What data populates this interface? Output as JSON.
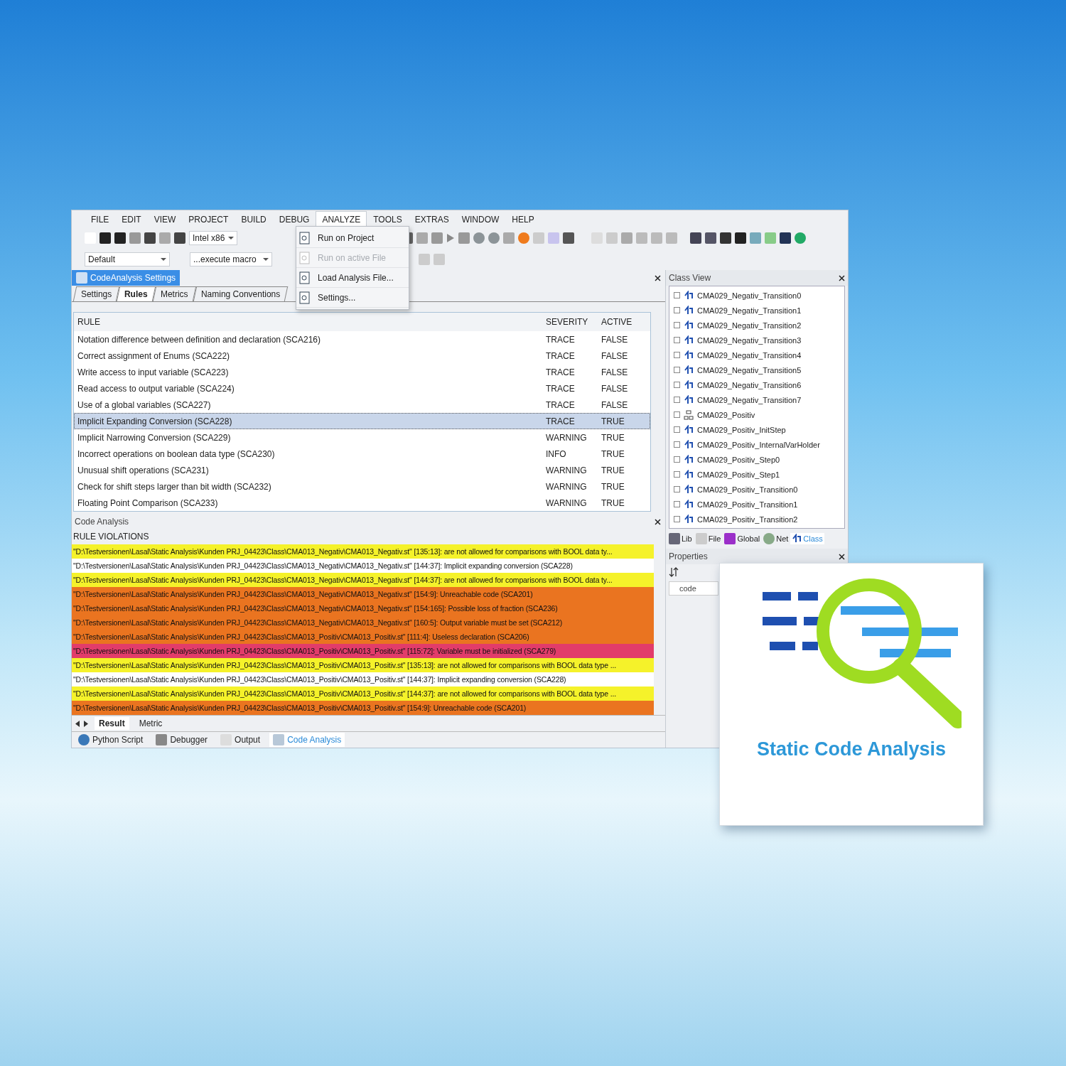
{
  "menu": [
    {
      "label": "FILE",
      "selected": false
    },
    {
      "label": "EDIT",
      "selected": false
    },
    {
      "label": "VIEW",
      "selected": false
    },
    {
      "label": "PROJECT",
      "selected": false
    },
    {
      "label": "BUILD",
      "selected": false
    },
    {
      "label": "DEBUG",
      "selected": false
    },
    {
      "label": "ANALYZE",
      "selected": true
    },
    {
      "label": "TOOLS",
      "selected": false
    },
    {
      "label": "EXTRAS",
      "selected": false
    },
    {
      "label": "WINDOW",
      "selected": false
    },
    {
      "label": "HELP",
      "selected": false
    }
  ],
  "analyze_menu": [
    {
      "label": "Run on Project",
      "disabled": false
    },
    {
      "label": "Run on active File",
      "disabled": true
    },
    {
      "label": "Load Analysis File...",
      "disabled": false
    },
    {
      "label": "Settings...",
      "disabled": false
    }
  ],
  "toolbar": {
    "platform": "Intel x86",
    "configuration": "Default",
    "macro": "...execute macro"
  },
  "document_tab": "CodeAnalysis Settings",
  "settings_tabs": [
    {
      "label": "Settings",
      "selected": false
    },
    {
      "label": "Rules",
      "selected": true
    },
    {
      "label": "Metrics",
      "selected": false
    },
    {
      "label": "Naming Conventions",
      "selected": false
    }
  ],
  "rules_table": {
    "columns": [
      "RULE",
      "SEVERITY",
      "ACTIVE"
    ],
    "rows": [
      {
        "rule": "Notation difference between definition and declaration (SCA216)",
        "severity": "TRACE",
        "active": "FALSE",
        "selected": false
      },
      {
        "rule": "Correct assignment of Enums (SCA222)",
        "severity": "TRACE",
        "active": "FALSE",
        "selected": false
      },
      {
        "rule": "Write access to input variable (SCA223)",
        "severity": "TRACE",
        "active": "FALSE",
        "selected": false
      },
      {
        "rule": "Read access to output variable (SCA224)",
        "severity": "TRACE",
        "active": "FALSE",
        "selected": false
      },
      {
        "rule": "Use of a global variables (SCA227)",
        "severity": "TRACE",
        "active": "FALSE",
        "selected": false
      },
      {
        "rule": "Implicit Expanding Conversion (SCA228)",
        "severity": "TRACE",
        "active": "TRUE",
        "selected": true
      },
      {
        "rule": "Implicit Narrowing Conversion (SCA229)",
        "severity": "WARNING",
        "active": "TRUE",
        "selected": false
      },
      {
        "rule": "Incorrect operations on boolean data type (SCA230)",
        "severity": "INFO",
        "active": "TRUE",
        "selected": false
      },
      {
        "rule": "Unusual shift operations (SCA231)",
        "severity": "WARNING",
        "active": "TRUE",
        "selected": false
      },
      {
        "rule": "Check for shift steps larger than bit width (SCA232)",
        "severity": "WARNING",
        "active": "TRUE",
        "selected": false
      },
      {
        "rule": "Floating Point Comparison (SCA233)",
        "severity": "WARNING",
        "active": "TRUE",
        "selected": false
      }
    ]
  },
  "code_analysis": {
    "title": "Code Analysis",
    "heading": "RULE VIOLATIONS",
    "rows": [
      {
        "text": "\"D:\\Testversionen\\Lasal\\Static Analysis\\Kunden PRJ_04423\\Class\\CMA013_Negativ\\CMA013_Negativ.st\" [135:13]: are not allowed for comparisons with BOOL data ty...",
        "color": "#f5f22a"
      },
      {
        "text": "\"D:\\Testversionen\\Lasal\\Static Analysis\\Kunden PRJ_04423\\Class\\CMA013_Negativ\\CMA013_Negativ.st\" [144:37]: Implicit expanding conversion (SCA228)",
        "color": "#ffffff"
      },
      {
        "text": "\"D:\\Testversionen\\Lasal\\Static Analysis\\Kunden PRJ_04423\\Class\\CMA013_Negativ\\CMA013_Negativ.st\" [144:37]: are not allowed for comparisons with BOOL data ty...",
        "color": "#f5f22a"
      },
      {
        "text": "\"D:\\Testversionen\\Lasal\\Static Analysis\\Kunden PRJ_04423\\Class\\CMA013_Negativ\\CMA013_Negativ.st\" [154:9]: Unreachable code (SCA201)",
        "color": "#ea7420"
      },
      {
        "text": "\"D:\\Testversionen\\Lasal\\Static Analysis\\Kunden PRJ_04423\\Class\\CMA013_Negativ\\CMA013_Negativ.st\" [154:165]: Possible loss of fraction (SCA236)",
        "color": "#ea7420"
      },
      {
        "text": "\"D:\\Testversionen\\Lasal\\Static Analysis\\Kunden PRJ_04423\\Class\\CMA013_Negativ\\CMA013_Negativ.st\" [160:5]: Output variable must be set (SCA212)",
        "color": "#ea7420"
      },
      {
        "text": "\"D:\\Testversionen\\Lasal\\Static Analysis\\Kunden PRJ_04423\\Class\\CMA013_Positiv\\CMA013_Positiv.st\" [111:4]: Useless declaration (SCA206)",
        "color": "#ea7420"
      },
      {
        "text": "\"D:\\Testversionen\\Lasal\\Static Analysis\\Kunden PRJ_04423\\Class\\CMA013_Positiv\\CMA013_Positiv.st\" [115:72]: Variable must be initialized (SCA279)",
        "color": "#e23c6a"
      },
      {
        "text": "\"D:\\Testversionen\\Lasal\\Static Analysis\\Kunden PRJ_04423\\Class\\CMA013_Positiv\\CMA013_Positiv.st\" [135:13]: are not allowed for comparisons with BOOL data type ...",
        "color": "#f5f22a"
      },
      {
        "text": "\"D:\\Testversionen\\Lasal\\Static Analysis\\Kunden PRJ_04423\\Class\\CMA013_Positiv\\CMA013_Positiv.st\" [144:37]: Implicit expanding conversion (SCA228)",
        "color": "#ffffff"
      },
      {
        "text": "\"D:\\Testversionen\\Lasal\\Static Analysis\\Kunden PRJ_04423\\Class\\CMA013_Positiv\\CMA013_Positiv.st\" [144:37]: are not allowed for comparisons with BOOL data type ...",
        "color": "#f5f22a"
      },
      {
        "text": "\"D:\\Testversionen\\Lasal\\Static Analysis\\Kunden PRJ_04423\\Class\\CMA013_Positiv\\CMA013_Positiv.st\" [154:9]: Unreachable code (SCA201)",
        "color": "#ea7420"
      }
    ]
  },
  "result_tabs": [
    {
      "label": "Result",
      "selected": true
    },
    {
      "label": "Metric",
      "selected": false
    }
  ],
  "output_tabs": [
    {
      "label": "Python Script",
      "kind": "python",
      "selected": false
    },
    {
      "label": "Debugger",
      "kind": "debugger",
      "selected": false
    },
    {
      "label": "Output",
      "kind": "output",
      "selected": false
    },
    {
      "label": "Code Analysis",
      "kind": "analysis",
      "selected": true
    }
  ],
  "class_view": {
    "title": "Class View",
    "items": [
      {
        "label": "CMA029_Negativ_Transition0",
        "kind": "transition"
      },
      {
        "label": "CMA029_Negativ_Transition1",
        "kind": "transition"
      },
      {
        "label": "CMA029_Negativ_Transition2",
        "kind": "transition"
      },
      {
        "label": "CMA029_Negativ_Transition3",
        "kind": "transition"
      },
      {
        "label": "CMA029_Negativ_Transition4",
        "kind": "transition"
      },
      {
        "label": "CMA029_Negativ_Transition5",
        "kind": "transition"
      },
      {
        "label": "CMA029_Negativ_Transition6",
        "kind": "transition"
      },
      {
        "label": "CMA029_Negativ_Transition7",
        "kind": "transition"
      },
      {
        "label": "CMA029_Positiv",
        "kind": "network"
      },
      {
        "label": "CMA029_Positiv_InitStep",
        "kind": "transition"
      },
      {
        "label": "CMA029_Positiv_InternalVarHolder",
        "kind": "transition"
      },
      {
        "label": "CMA029_Positiv_Step0",
        "kind": "transition"
      },
      {
        "label": "CMA029_Positiv_Step1",
        "kind": "transition"
      },
      {
        "label": "CMA029_Positiv_Transition0",
        "kind": "transition"
      },
      {
        "label": "CMA029_Positiv_Transition1",
        "kind": "transition"
      },
      {
        "label": "CMA029_Positiv_Transition2",
        "kind": "transition"
      }
    ],
    "tabs": [
      {
        "label": "Lib",
        "kind": "lib",
        "selected": false
      },
      {
        "label": "File",
        "kind": "file",
        "selected": false
      },
      {
        "label": "Global",
        "kind": "global",
        "selected": false
      },
      {
        "label": "Net",
        "kind": "net",
        "selected": false
      },
      {
        "label": "Class",
        "kind": "class",
        "selected": true
      }
    ]
  },
  "properties": {
    "title": "Properties",
    "field": "code"
  },
  "badge": {
    "title": "Static Code Analysis"
  }
}
